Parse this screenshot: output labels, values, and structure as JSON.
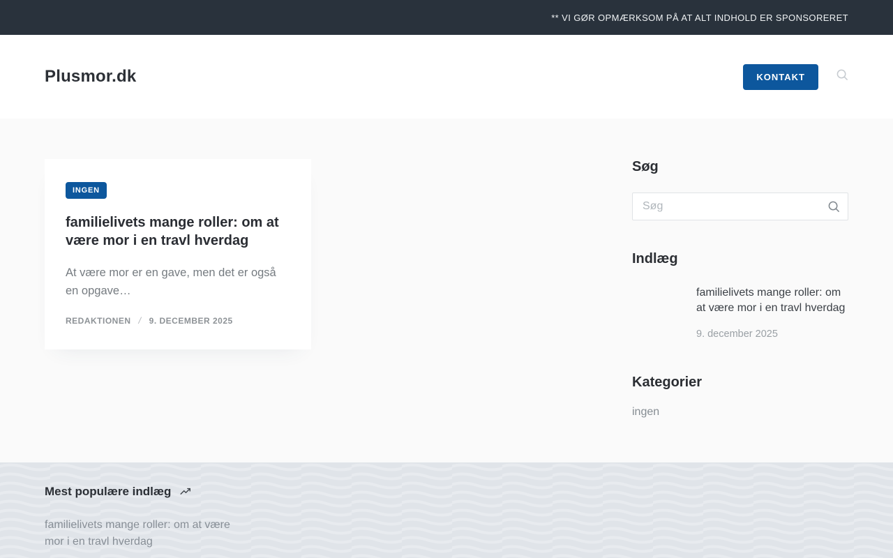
{
  "banner": {
    "text": "** VI GØR OPMÆRKSOM PÅ AT ALT INDHOLD ER SPONSORERET"
  },
  "header": {
    "logo": "Plusmor.dk",
    "contact_button_label": "KONTAKT"
  },
  "post_card": {
    "category_badge": "INGEN",
    "title": "familielivets mange roller: om at være mor i en travl hverdag",
    "excerpt": "At være mor er en gave, men det er også en opgave…",
    "author": "REDAKTIONEN",
    "meta_separator": "/",
    "date": "9. DECEMBER 2025"
  },
  "sidebar": {
    "search": {
      "heading": "Søg",
      "placeholder": "Søg"
    },
    "posts": {
      "heading": "Indlæg",
      "items": [
        {
          "title": "familielivets mange roller: om at være mor i en travl hverdag",
          "date": "9. december 2025"
        }
      ]
    },
    "categories": {
      "heading": "Kategorier",
      "items": [
        {
          "label": "ingen"
        }
      ]
    }
  },
  "footer": {
    "heading": "Mest populære indlæg",
    "popular_posts": [
      {
        "title": "familielivets mange roller: om at være mor i en travl hverdag"
      }
    ]
  },
  "colors": {
    "accent_blue": "#0d579d",
    "banner_bg": "#29323c",
    "page_bg": "#fafafa",
    "footer_bg": "#e0e4e9",
    "footer_wave_line": "#e8ebef"
  }
}
